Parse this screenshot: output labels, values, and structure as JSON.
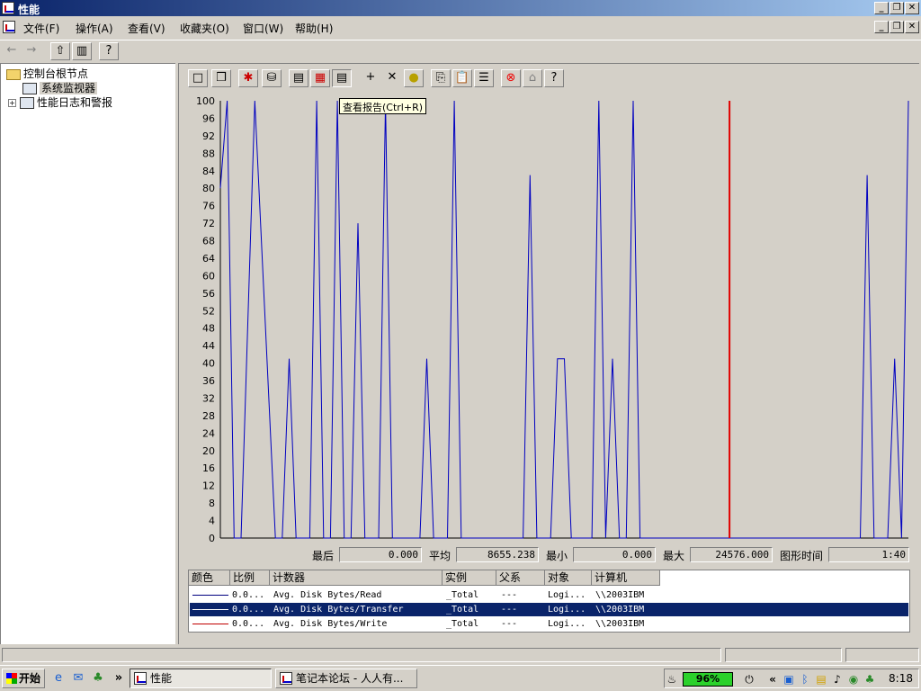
{
  "window": {
    "title": "性能"
  },
  "menu": [
    "文件(F)",
    "操作(A)",
    "查看(V)",
    "收藏夹(O)",
    "窗口(W)",
    "帮助(H)"
  ],
  "tree": {
    "root": "控制台根节点",
    "items": [
      "系统监视器",
      "性能日志和警报"
    ]
  },
  "tooltip": "查看报告(Ctrl+R)",
  "chart_data": {
    "type": "line",
    "y_ticks": [
      "100",
      "96",
      "92",
      "88",
      "84",
      "80",
      "76",
      "72",
      "68",
      "64",
      "60",
      "56",
      "52",
      "48",
      "44",
      "40",
      "36",
      "32",
      "28",
      "24",
      "20",
      "16",
      "12",
      "8",
      "4",
      "0"
    ],
    "ylim": [
      0,
      100
    ],
    "grid": false,
    "current_time_marker_x": 74,
    "series": [
      {
        "name": "Avg. Disk Bytes/Transfer",
        "color": "#0000c0",
        "x": [
          0,
          1,
          2,
          3,
          5,
          8,
          9,
          10,
          11,
          12,
          13,
          14,
          15,
          16,
          17,
          18,
          19,
          20,
          21,
          22,
          23,
          24,
          25,
          26,
          27,
          28,
          29,
          30,
          31,
          32,
          33,
          34,
          35,
          37,
          38,
          39,
          40,
          41,
          42,
          43,
          44,
          45,
          46,
          47,
          48,
          49,
          50,
          51,
          52,
          53,
          54,
          55,
          56,
          57,
          58,
          59,
          60,
          61,
          62,
          63,
          64,
          65,
          66,
          67,
          68,
          69,
          70,
          71,
          72,
          73,
          74,
          75,
          76,
          77,
          78,
          79,
          80,
          81,
          82,
          83,
          84,
          85,
          86,
          87,
          88,
          89,
          90,
          91,
          92,
          93,
          94,
          95,
          96,
          97,
          98,
          99,
          100
        ],
        "y": [
          80,
          100,
          0,
          0,
          100,
          0,
          0,
          41,
          0,
          0,
          0,
          100,
          0,
          0,
          100,
          0,
          0,
          72,
          0,
          0,
          0,
          100,
          0,
          0,
          0,
          0,
          0,
          41,
          0,
          0,
          0,
          100,
          0,
          0,
          0,
          0,
          0,
          0,
          0,
          0,
          0,
          83,
          0,
          0,
          0,
          41,
          41,
          0,
          0,
          0,
          0,
          100,
          0,
          41,
          0,
          0,
          100,
          0,
          0,
          0,
          0,
          0,
          0,
          0,
          0,
          0,
          0,
          0,
          0,
          0,
          0,
          0,
          0,
          0,
          0,
          0,
          0,
          0,
          0,
          0,
          0,
          0,
          0,
          0,
          0,
          0,
          0,
          0,
          0,
          0,
          83,
          0,
          0,
          0,
          41,
          0,
          100
        ]
      }
    ]
  },
  "stats": {
    "last_label": "最后",
    "last_value": "0.000",
    "avg_label": "平均",
    "avg_value": "8655.238",
    "min_label": "最小",
    "min_value": "0.000",
    "max_label": "最大",
    "max_value": "24576.000",
    "time_label": "图形时间",
    "time_value": "1:40"
  },
  "counters": {
    "headers": [
      "颜色",
      "比例",
      "计数器",
      "实例",
      "父系",
      "对象",
      "计算机"
    ],
    "rows": [
      {
        "color": "#000080",
        "scale": "0.0...",
        "counter": "Avg. Disk Bytes/Read",
        "instance": "_Total",
        "parent": "---",
        "object": "Logi...",
        "computer": "\\\\2003IBM"
      },
      {
        "color": "#0000c0",
        "scale": "0.0...",
        "counter": "Avg. Disk Bytes/Transfer",
        "instance": "_Total",
        "parent": "---",
        "object": "Logi...",
        "computer": "\\\\2003IBM"
      },
      {
        "color": "#c00000",
        "scale": "0.0...",
        "counter": "Avg. Disk Bytes/Write",
        "instance": "_Total",
        "parent": "---",
        "object": "Logi...",
        "computer": "\\\\2003IBM"
      }
    ]
  },
  "taskbar": {
    "start": "开始",
    "tasks": [
      "性能",
      "笔记本论坛 - 人人有..."
    ],
    "battery": "96%",
    "clock": "8:18"
  }
}
